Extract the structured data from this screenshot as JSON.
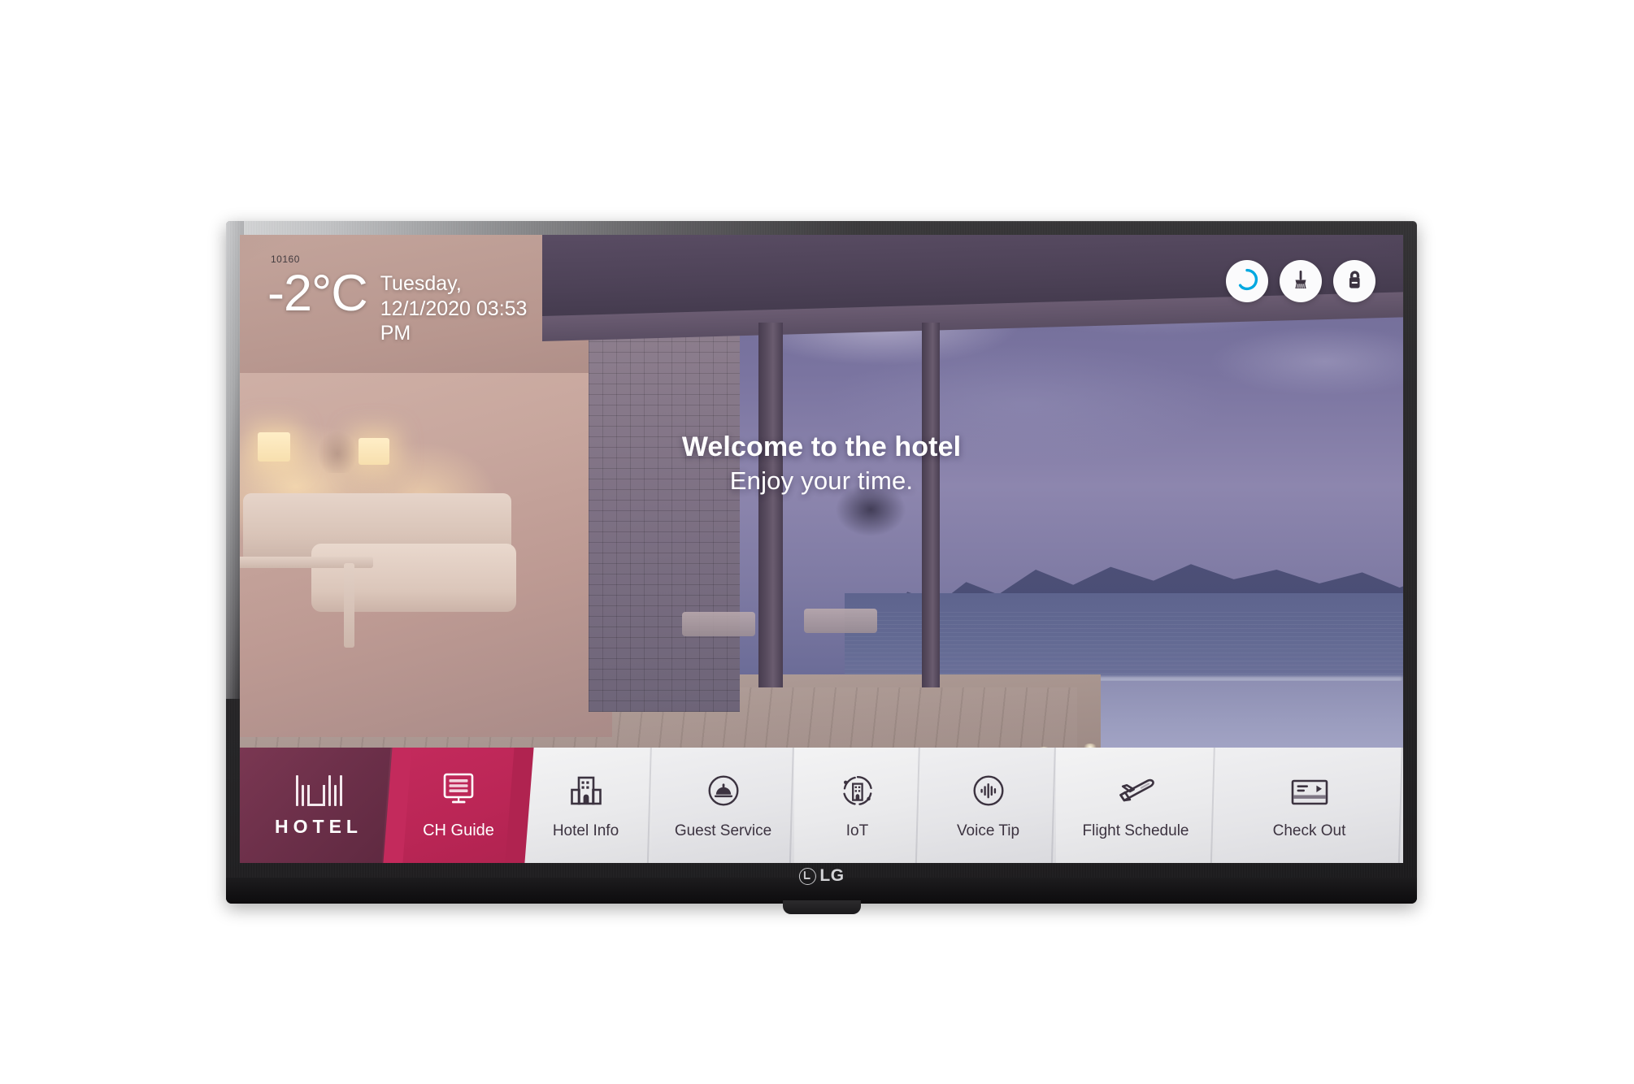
{
  "device": {
    "brand": "LG",
    "brand_mark_name": "lg-circle-logo"
  },
  "screen": {
    "room_number": "10160",
    "weather": {
      "temperature": "-2°C"
    },
    "datetime": {
      "day": "Tuesday,",
      "date_time": "12/1/2020 03:53 PM"
    },
    "status_buttons": [
      {
        "name": "voice-assistant-icon",
        "label": "Voice Assistant",
        "color": "#00a8e0"
      },
      {
        "name": "room-cleaning-icon",
        "label": "Make Up Room",
        "color": "#3c3340"
      },
      {
        "name": "do-not-disturb-icon",
        "label": "Do Not Disturb",
        "color": "#3c3340"
      }
    ],
    "welcome": {
      "title": "Welcome to the hotel",
      "subtitle": "Enjoy your time."
    },
    "nav": {
      "logo": {
        "word": "HOTEL",
        "mark_name": "hotel-bars-mark"
      },
      "items": [
        {
          "id": "ch-guide",
          "label": "CH Guide",
          "icon": "tv-list-icon",
          "selected": true
        },
        {
          "id": "hotel-info",
          "label": "Hotel Info",
          "icon": "building-icon",
          "selected": false
        },
        {
          "id": "guest-service",
          "label": "Guest Service",
          "icon": "service-bell-icon",
          "selected": false
        },
        {
          "id": "iot",
          "label": "IoT",
          "icon": "iot-building-icon",
          "selected": false
        },
        {
          "id": "voice-tip",
          "label": "Voice Tip",
          "icon": "voice-wave-icon",
          "selected": false
        },
        {
          "id": "flight-schedule",
          "label": "Flight Schedule",
          "icon": "airplane-icon",
          "selected": false
        },
        {
          "id": "check-out",
          "label": "Check Out",
          "icon": "keycard-icon",
          "selected": false
        }
      ]
    }
  },
  "theme": {
    "accent_selected": "#c32a5c",
    "logo_panel": "#6d304a",
    "nav_light": "#ececee",
    "nav_text": "#3c3340",
    "bezel": "#242325"
  }
}
